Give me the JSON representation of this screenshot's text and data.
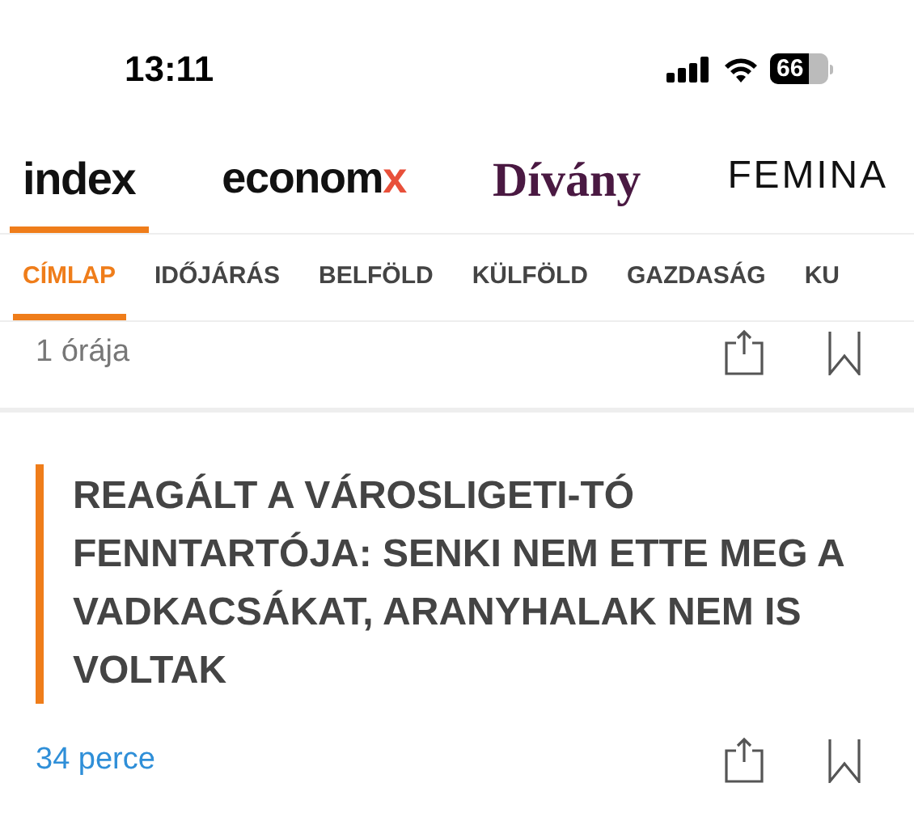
{
  "status_bar": {
    "time": "13:11",
    "battery": "66"
  },
  "brands": [
    {
      "label": "index",
      "kind": "index",
      "selected": true
    },
    {
      "label": "econom",
      "accent": "x",
      "kind": "economx",
      "selected": false
    },
    {
      "label": "Dívány",
      "kind": "divany",
      "selected": false
    },
    {
      "label": "FEMINA",
      "kind": "femina",
      "selected": false
    }
  ],
  "categories": [
    {
      "label": "CÍMLAP",
      "selected": true
    },
    {
      "label": "IDŐJÁRÁS",
      "selected": false
    },
    {
      "label": "BELFÖLD",
      "selected": false
    },
    {
      "label": "KÜLFÖLD",
      "selected": false
    },
    {
      "label": "GAZDASÁG",
      "selected": false
    },
    {
      "label": "KU",
      "selected": false
    }
  ],
  "articles": [
    {
      "time": "1 órája",
      "recent": false
    },
    {
      "title": "REAGÁLT A VÁROSLIGETI-TÓ FENNTARTÓJA: SENKI NEM ETTE MEG A VADKACSÁKAT, ARANYHALAK NEM IS VOLTAK",
      "time": "34 perce",
      "recent": true
    }
  ]
}
